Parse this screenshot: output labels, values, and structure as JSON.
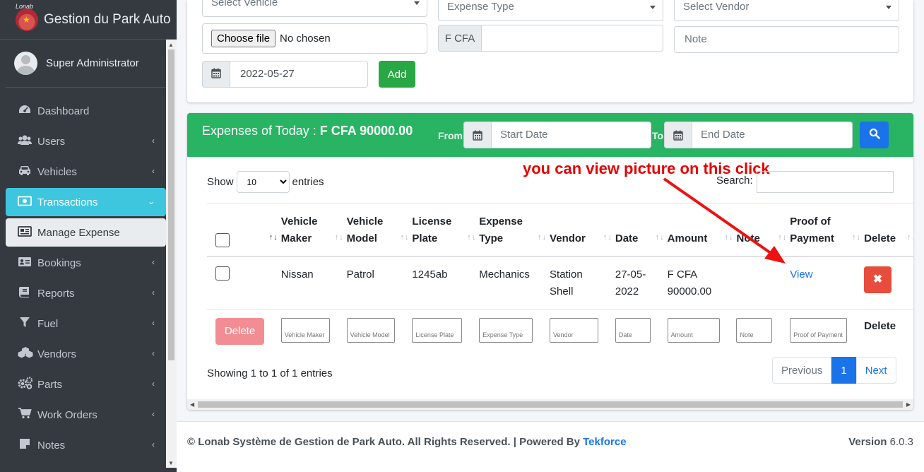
{
  "sidebar": {
    "brand_logo_text": "Lonab",
    "brand_title": "Gestion du Park Auto",
    "user_name": "Super Administrator",
    "items": [
      {
        "label": "Dashboard",
        "icon": "dashboard-icon"
      },
      {
        "label": "Users",
        "icon": "users-icon"
      },
      {
        "label": "Vehicles",
        "icon": "car-icon"
      },
      {
        "label": "Transactions",
        "icon": "money-icon"
      },
      {
        "label": "Manage Expense",
        "icon": "list-icon"
      },
      {
        "label": "Bookings",
        "icon": "address-card-icon"
      },
      {
        "label": "Reports",
        "icon": "book-icon"
      },
      {
        "label": "Fuel",
        "icon": "filter-icon"
      },
      {
        "label": "Vendors",
        "icon": "cubes-icon"
      },
      {
        "label": "Parts",
        "icon": "gears-icon"
      },
      {
        "label": "Work Orders",
        "icon": "cart-icon"
      },
      {
        "label": "Notes",
        "icon": "note-icon"
      }
    ]
  },
  "form": {
    "vehicle_placeholder": "Select Vehicle",
    "expense_type_placeholder": "Expense Type",
    "vendor_placeholder": "Select Vendor",
    "file_button": "Choose file",
    "file_status": "No chosen",
    "currency_addon": "F CFA",
    "note_placeholder": "Note",
    "date_value": "2022-05-27",
    "add_button": "Add"
  },
  "expenses": {
    "title_prefix": "Expenses of Today :",
    "title_amount": "F CFA 90000.00",
    "from_label": "From",
    "to_label": "To",
    "start_placeholder": "Start Date",
    "end_placeholder": "End Date",
    "annotation": "you can view picture on this click",
    "show_label": "Show",
    "entries_label": "entries",
    "page_length": "10",
    "search_label": "Search:",
    "columns": {
      "sort": "↑↓",
      "maker_1": "Vehicle",
      "maker_2": "Maker",
      "model_1": "Vehicle",
      "model_2": "Model",
      "plate_1": "License",
      "plate_2": "Plate",
      "type_1": "Expense",
      "type_2": "Type",
      "vendor": "Vendor",
      "date": "Date",
      "amount": "Amount",
      "note": "Note",
      "proof_1": "Proof of",
      "proof_2": "Payment",
      "delete": "Delete"
    },
    "row": {
      "maker": "Nissan",
      "model": "Patrol",
      "plate": "1245ab",
      "type": "Mechanics",
      "vendor_1": "Station",
      "vendor_2": "Shell",
      "date_1": "27-05-",
      "date_2": "2022",
      "amount_1": "F CFA",
      "amount_2": "90000.00",
      "note": "",
      "proof_link": "View",
      "delete_icon": "✖"
    },
    "footer_filters": {
      "delete_button": "Delete",
      "maker": "Vehicle Maker",
      "model": "Vehicle Model",
      "plate": "License Plate",
      "type": "Expense Type",
      "vendor": "Vendor",
      "date": "Date",
      "amount": "Amount",
      "note": "Note",
      "proof": "Proof of Payment",
      "delete_label": "Delete"
    },
    "showing": "Showing 1 to 1 of 1 entries",
    "pager": {
      "prev": "Previous",
      "current": "1",
      "next": "Next"
    }
  },
  "footer": {
    "copyright": "© Lonab Système de Gestion de Park Auto. All Rights Reserved. | Powered By",
    "powered_by": "Tekforce",
    "version_label": "Version",
    "version": "6.0.3"
  },
  "colors": {
    "sidebar_bg": "#343a40",
    "active_item": "#3ec6df",
    "header_green": "#28b463",
    "add_green": "#28a745",
    "primary_blue": "#1a73e8",
    "danger_red": "#e74c3c",
    "annotation_red": "#e60000"
  }
}
